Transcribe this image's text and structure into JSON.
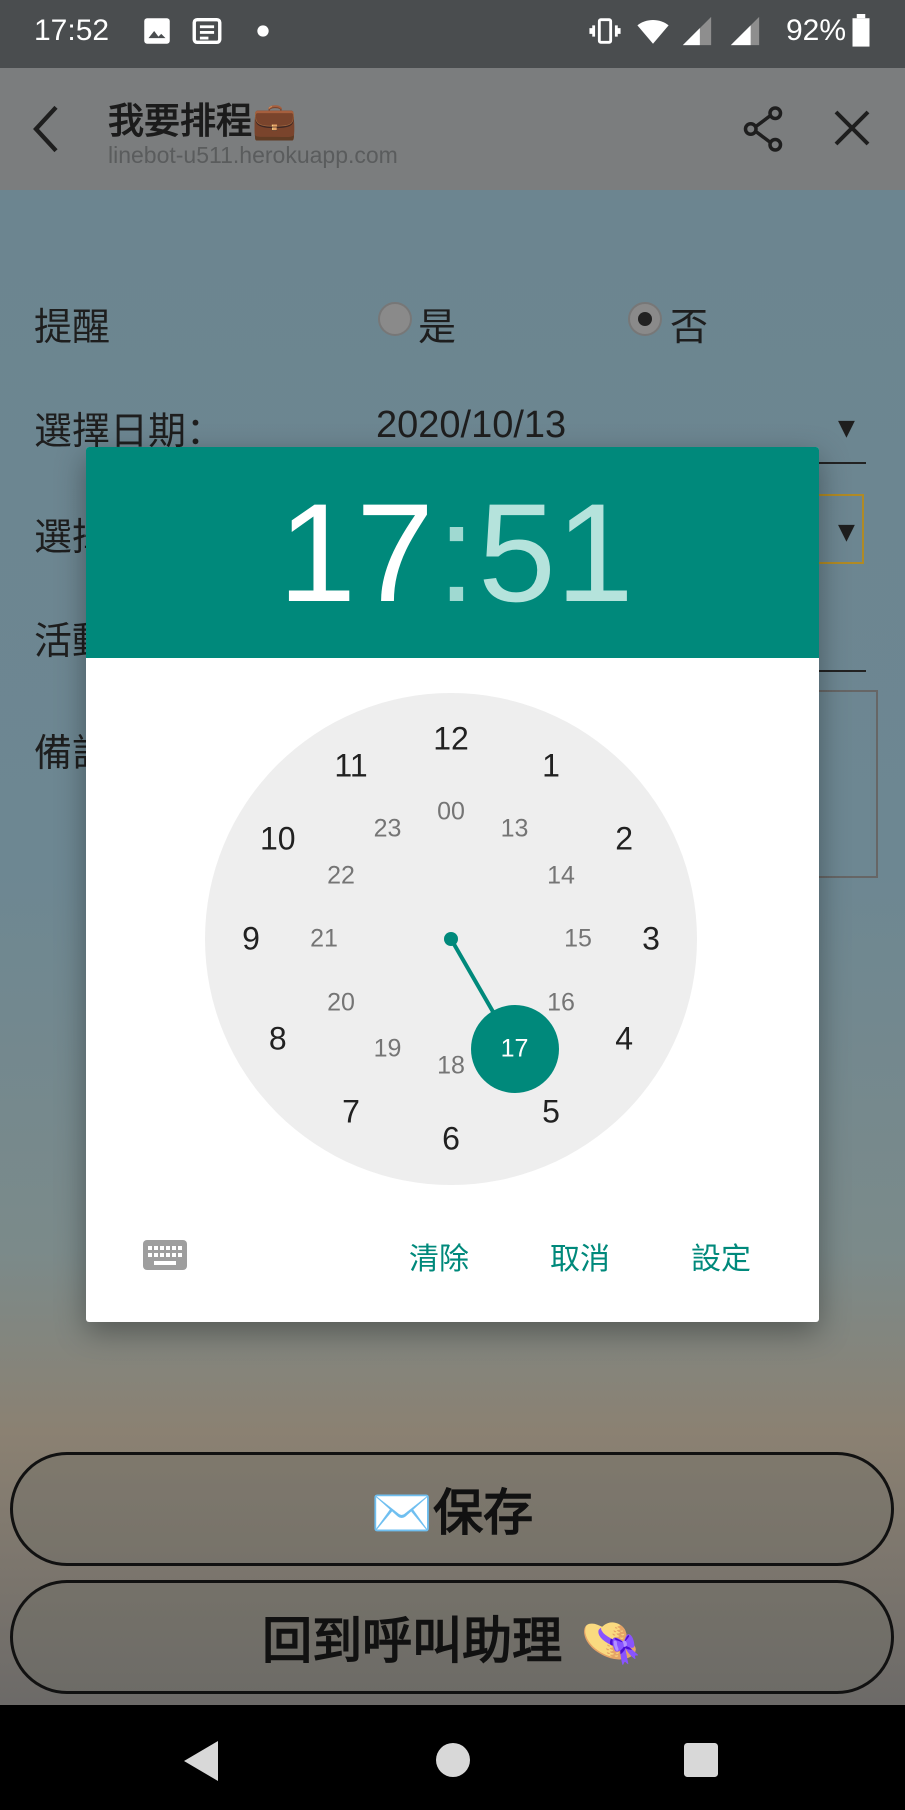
{
  "status_bar": {
    "time": "17:52",
    "battery": "92%",
    "icons": [
      "image-icon",
      "news-icon",
      "dot-icon",
      "vibrate-icon",
      "wifi-icon",
      "signal-icon",
      "signal-icon",
      "battery-icon"
    ]
  },
  "app_bar": {
    "title": "我要排程💼",
    "url": "linebot-u511.herokuapp.com"
  },
  "form": {
    "reminder_label": "提醒",
    "yes_label": "是",
    "no_label": "否",
    "reminder_selected": "否",
    "date_label": "選擇日期：",
    "date_value": "2020/10/13",
    "time_label_partial": "選擇",
    "activity_label_partial": "活動",
    "notes_label_partial": "備註"
  },
  "buttons": {
    "save": "✉️保存",
    "back_to_assistant": "回到呼叫助理 👒"
  },
  "time_picker": {
    "hour": "17",
    "colon": ":",
    "minute": "51",
    "outer_numbers": [
      "12",
      "1",
      "2",
      "3",
      "4",
      "5",
      "6",
      "7",
      "8",
      "9",
      "10",
      "11"
    ],
    "inner_numbers": [
      "00",
      "13",
      "14",
      "15",
      "16",
      "17",
      "18",
      "19",
      "20",
      "21",
      "22",
      "23"
    ],
    "selected_hour": "17",
    "actions": {
      "clear": "清除",
      "cancel": "取消",
      "set": "設定"
    }
  },
  "colors": {
    "accent": "#00897b",
    "dial_bg": "#eeeeee"
  }
}
